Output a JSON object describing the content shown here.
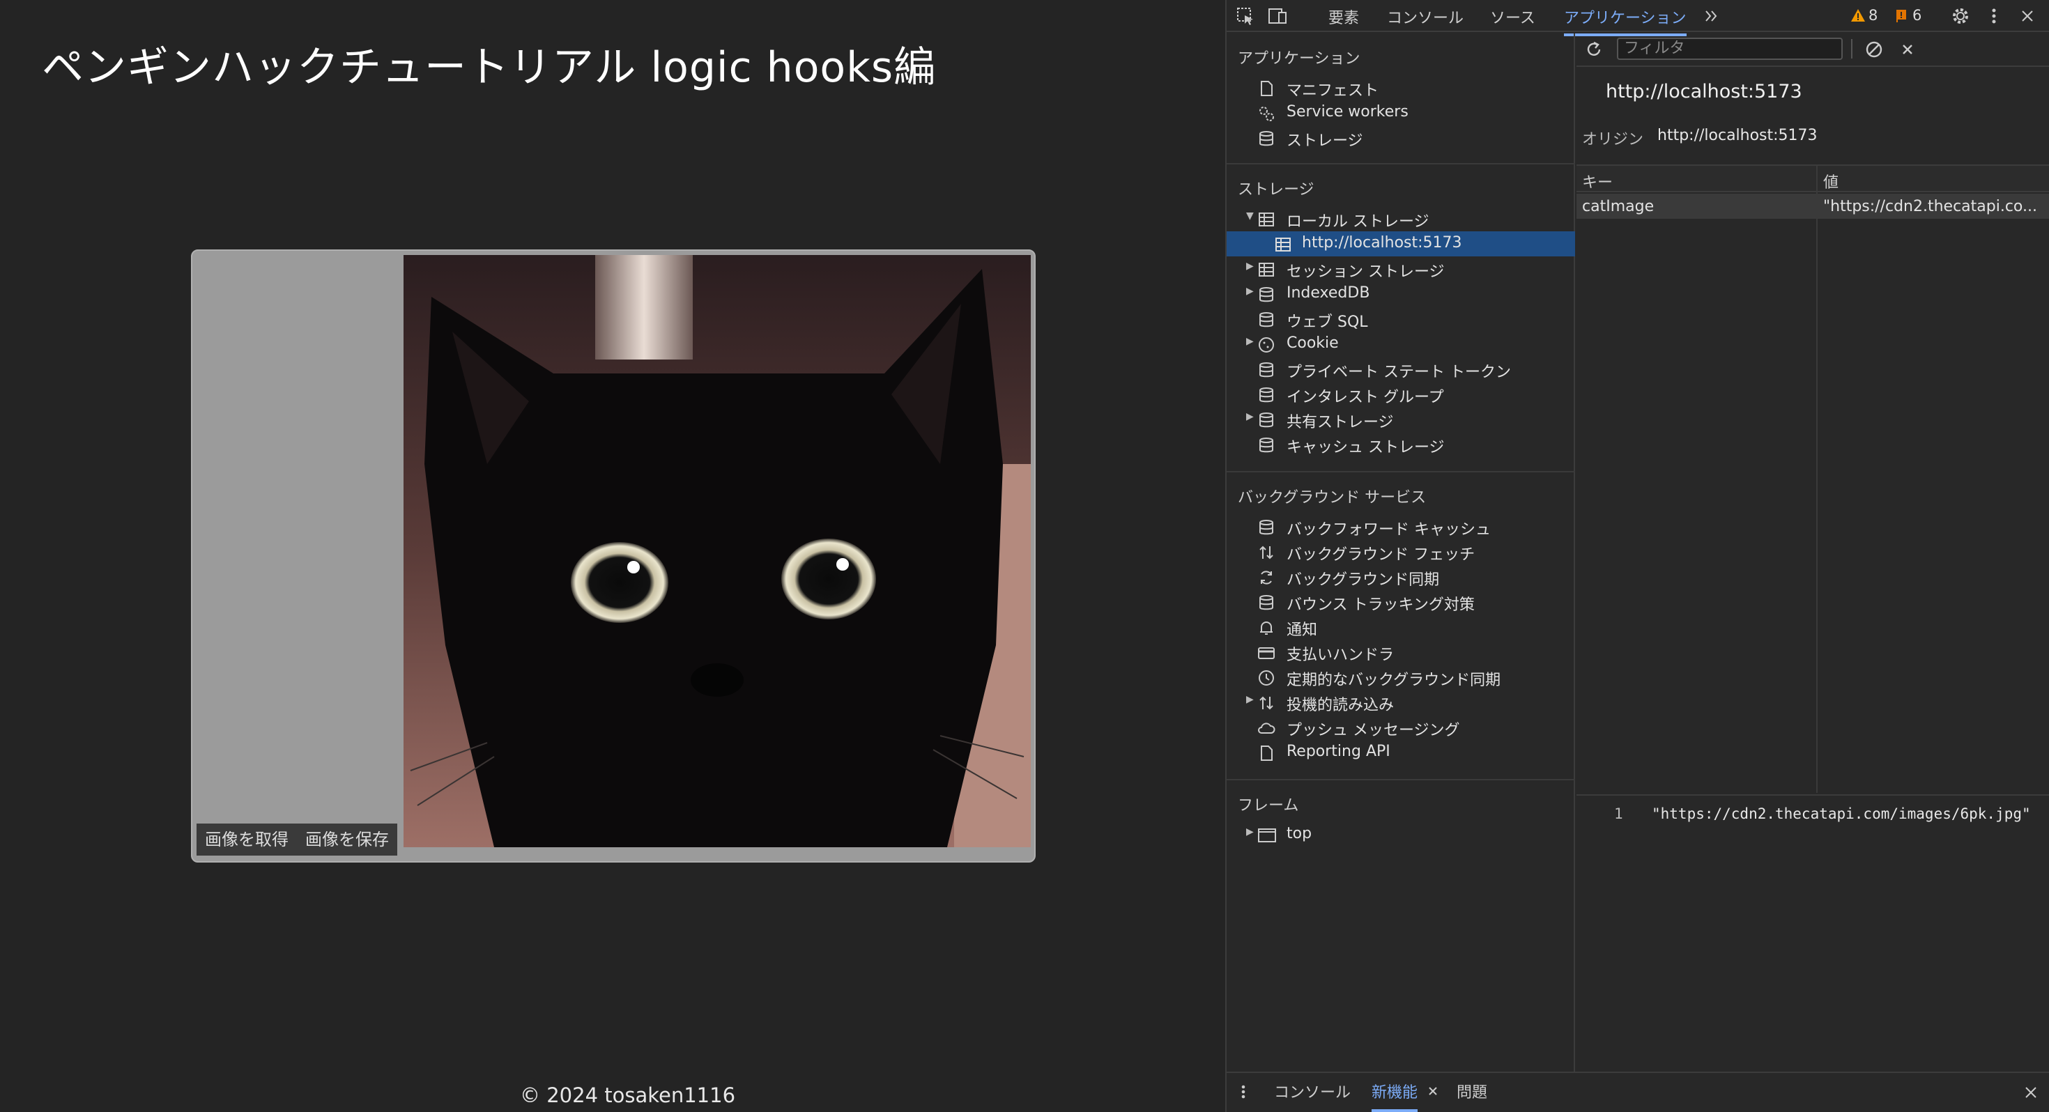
{
  "app": {
    "title": "ペンギンハックチュートリアル logic hooks編",
    "buttons": {
      "fetch": "画像を取得",
      "save": "画像を保存"
    },
    "footer": "© 2024 tosaken1116"
  },
  "devtools": {
    "tabs": {
      "elements": "要素",
      "console": "コンソール",
      "sources": "ソース",
      "application": "アプリケーション"
    },
    "warnings": "8",
    "issues": "6",
    "sidebar": {
      "app_header": "アプリケーション",
      "manifest": "マニフェスト",
      "service_workers": "Service workers",
      "storage_item": "ストレージ",
      "storage_header": "ストレージ",
      "local_storage": "ローカル ストレージ",
      "local_origin": "http://localhost:5173",
      "session_storage": "セッション ストレージ",
      "indexeddb": "IndexedDB",
      "websql": "ウェブ SQL",
      "cookie": "Cookie",
      "private_state": "プライベート ステート トークン",
      "interest_groups": "インタレスト グループ",
      "shared_storage": "共有ストレージ",
      "cache_storage": "キャッシュ ストレージ",
      "bg_header": "バックグラウンド サービス",
      "bfcache": "バックフォワード キャッシュ",
      "bg_fetch": "バックグラウンド フェッチ",
      "bg_sync": "バックグラウンド同期",
      "bounce": "バウンス トラッキング対策",
      "notifications": "通知",
      "payment": "支払いハンドラ",
      "periodic_sync": "定期的なバックグラウンド同期",
      "speculative": "投機的読み込み",
      "push": "プッシュ メッセージング",
      "reporting": "Reporting API",
      "frames_header": "フレーム",
      "frame_top": "top"
    },
    "main": {
      "filter_placeholder": "フィルタ",
      "origin_title": "http://localhost:5173",
      "origin_label": "オリジン",
      "origin_value": "http://localhost:5173",
      "col_key": "キー",
      "col_value": "値",
      "row_key": "catImage",
      "row_value": "\"https://cdn2.thecatapi.co...",
      "preview_line": "1",
      "preview_value": "\"https://cdn2.thecatapi.com/images/6pk.jpg\""
    },
    "drawer": {
      "console": "コンソール",
      "whats_new": "新機能",
      "issues": "問題"
    }
  },
  "colors": {
    "accent": "#7cacf8",
    "selection": "#1f4e86",
    "warning": "#f29900",
    "issue": "#e37400"
  }
}
